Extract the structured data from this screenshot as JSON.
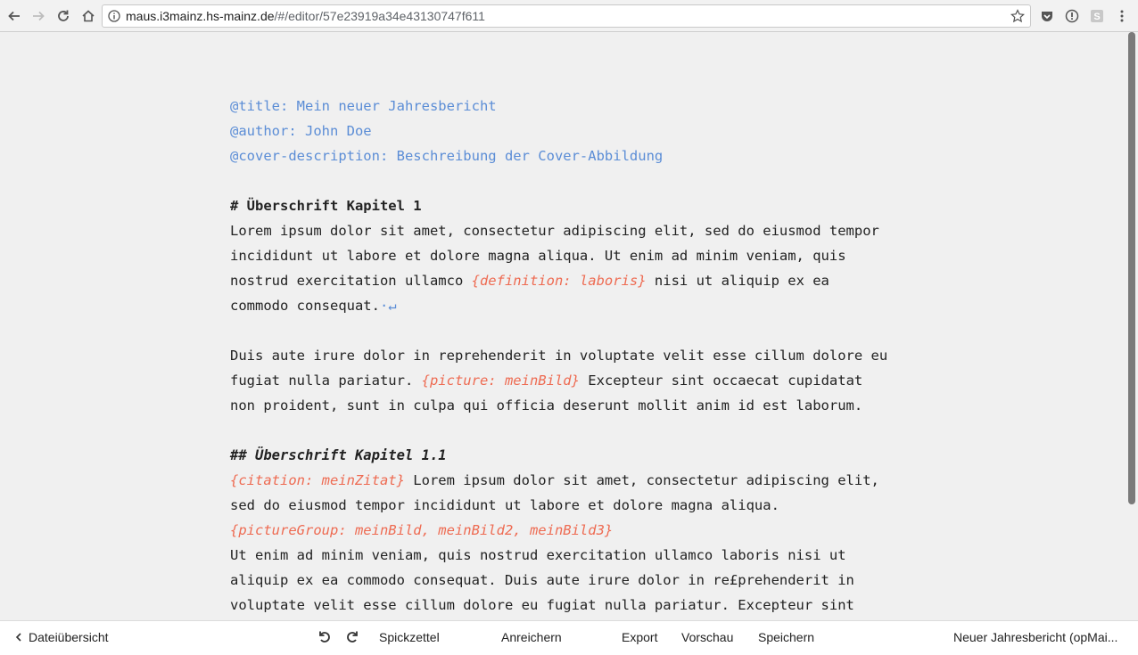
{
  "browser": {
    "url_host": "maus.i3mainz.hs-mainz.de",
    "url_path": "/#/editor/57e23919a34e43130747f611"
  },
  "editor": {
    "lines": [
      {
        "segments": [
          {
            "text": "@title: Mein neuer Jahresbericht",
            "style": "meta"
          }
        ]
      },
      {
        "segments": [
          {
            "text": "@author: John Doe",
            "style": "meta"
          }
        ]
      },
      {
        "segments": [
          {
            "text": "@cover-description: Beschreibung der Cover-Abbildung",
            "style": "meta"
          }
        ]
      },
      {
        "segments": []
      },
      {
        "segments": [
          {
            "text": "# Überschrift Kapitel 1",
            "style": "heading"
          }
        ]
      },
      {
        "segments": [
          {
            "text": "Lorem ipsum dolor sit amet, consectetur adipiscing elit, sed do eiusmod tempor",
            "style": "text"
          }
        ]
      },
      {
        "segments": [
          {
            "text": "incididunt ut labore et dolore magna aliqua. Ut enim ad minim veniam, quis",
            "style": "text"
          }
        ]
      },
      {
        "segments": [
          {
            "text": "nostrud exercitation ullamco ",
            "style": "text"
          },
          {
            "text": "{definition: laboris}",
            "style": "tag"
          },
          {
            "text": " nisi ut aliquip ex ea",
            "style": "text"
          }
        ]
      },
      {
        "segments": [
          {
            "text": "commodo consequat.",
            "style": "text"
          },
          {
            "text": "·↵",
            "style": "ret"
          }
        ]
      },
      {
        "segments": []
      },
      {
        "segments": [
          {
            "text": "Duis aute irure dolor in reprehenderit in voluptate velit esse cillum dolore eu",
            "style": "text"
          }
        ]
      },
      {
        "segments": [
          {
            "text": "fugiat nulla pariatur. ",
            "style": "text"
          },
          {
            "text": "{picture: meinBild}",
            "style": "tag"
          },
          {
            "text": " Excepteur sint occaecat cupidatat",
            "style": "text"
          }
        ]
      },
      {
        "segments": [
          {
            "text": "non proident, sunt in culpa qui officia deserunt mollit anim id est laborum.",
            "style": "text"
          }
        ]
      },
      {
        "segments": []
      },
      {
        "segments": [
          {
            "text": "## Überschrift Kapitel 1.1",
            "style": "heading-it"
          }
        ]
      },
      {
        "segments": [
          {
            "text": "{citation: meinZitat}",
            "style": "tag"
          },
          {
            "text": " Lorem ipsum dolor sit amet, consectetur adipiscing elit,",
            "style": "text"
          }
        ]
      },
      {
        "segments": [
          {
            "text": "sed do eiusmod tempor incididunt ut labore et dolore magna aliqua.",
            "style": "text"
          }
        ]
      },
      {
        "segments": [
          {
            "text": "{pictureGroup: meinBild, meinBild2, meinBild3}",
            "style": "tag"
          }
        ]
      },
      {
        "segments": [
          {
            "text": "Ut enim ad minim veniam, quis nostrud exercitation ullamco laboris nisi ut",
            "style": "text"
          }
        ]
      },
      {
        "segments": [
          {
            "text": "aliquip ex ea commodo consequat. Duis aute irure dolor in re£prehenderit in",
            "style": "text"
          }
        ]
      },
      {
        "segments": [
          {
            "text": "voluptate velit esse cillum dolore eu fugiat nulla pariatur. Excepteur sint",
            "style": "text"
          }
        ]
      }
    ]
  },
  "toolbar": {
    "back_label": "Dateiübersicht",
    "cheatsheet_label": "Spickzettel",
    "enrich_label": "Anreichern",
    "export_label": "Export",
    "preview_label": "Vorschau",
    "save_label": "Speichern",
    "doc_title": "Neuer Jahresbericht (opMai..."
  },
  "colors": {
    "meta": "#5b8dd6",
    "tag": "#ee6b52",
    "text": "#222222"
  }
}
